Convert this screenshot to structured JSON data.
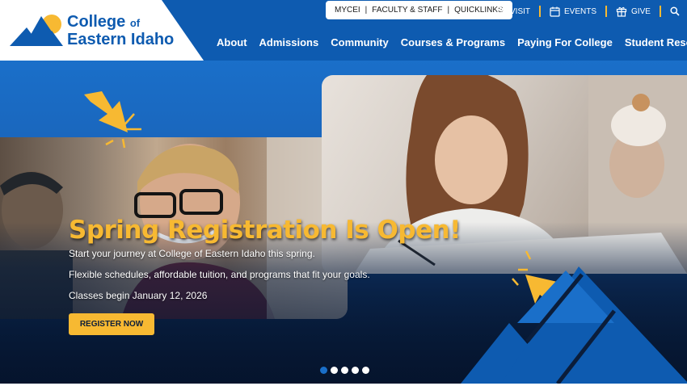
{
  "header": {
    "logo": {
      "line1": "College",
      "line1_suffix": "of",
      "line2": "Eastern Idaho"
    },
    "utility_links": [
      "MYCEI",
      "FACULTY & STAFF",
      "QUICKLINKS"
    ],
    "utility_separator": "|",
    "actions": [
      {
        "label": "VISIT",
        "icon": "map-pin-icon"
      },
      {
        "label": "EVENTS",
        "icon": "calendar-icon"
      },
      {
        "label": "GIVE",
        "icon": "gift-icon"
      }
    ],
    "search_icon": "search-icon",
    "nav": [
      "About",
      "Admissions",
      "Community",
      "Courses & Programs",
      "Paying For College",
      "Student Resources"
    ]
  },
  "hero": {
    "headline": "Spring Registration Is Open!",
    "lines": [
      "Start your journey at College of Eastern Idaho this spring.",
      "Flexible schedules, affordable tuition, and programs that fit your goals.",
      "Classes begin January 12, 2026"
    ],
    "cta_label": "REGISTER NOW",
    "slides_total": 5,
    "active_slide": 1
  },
  "colors": {
    "brand_blue": "#0e5bb0",
    "accent_gold": "#f7b932",
    "navy": "#06162e"
  }
}
